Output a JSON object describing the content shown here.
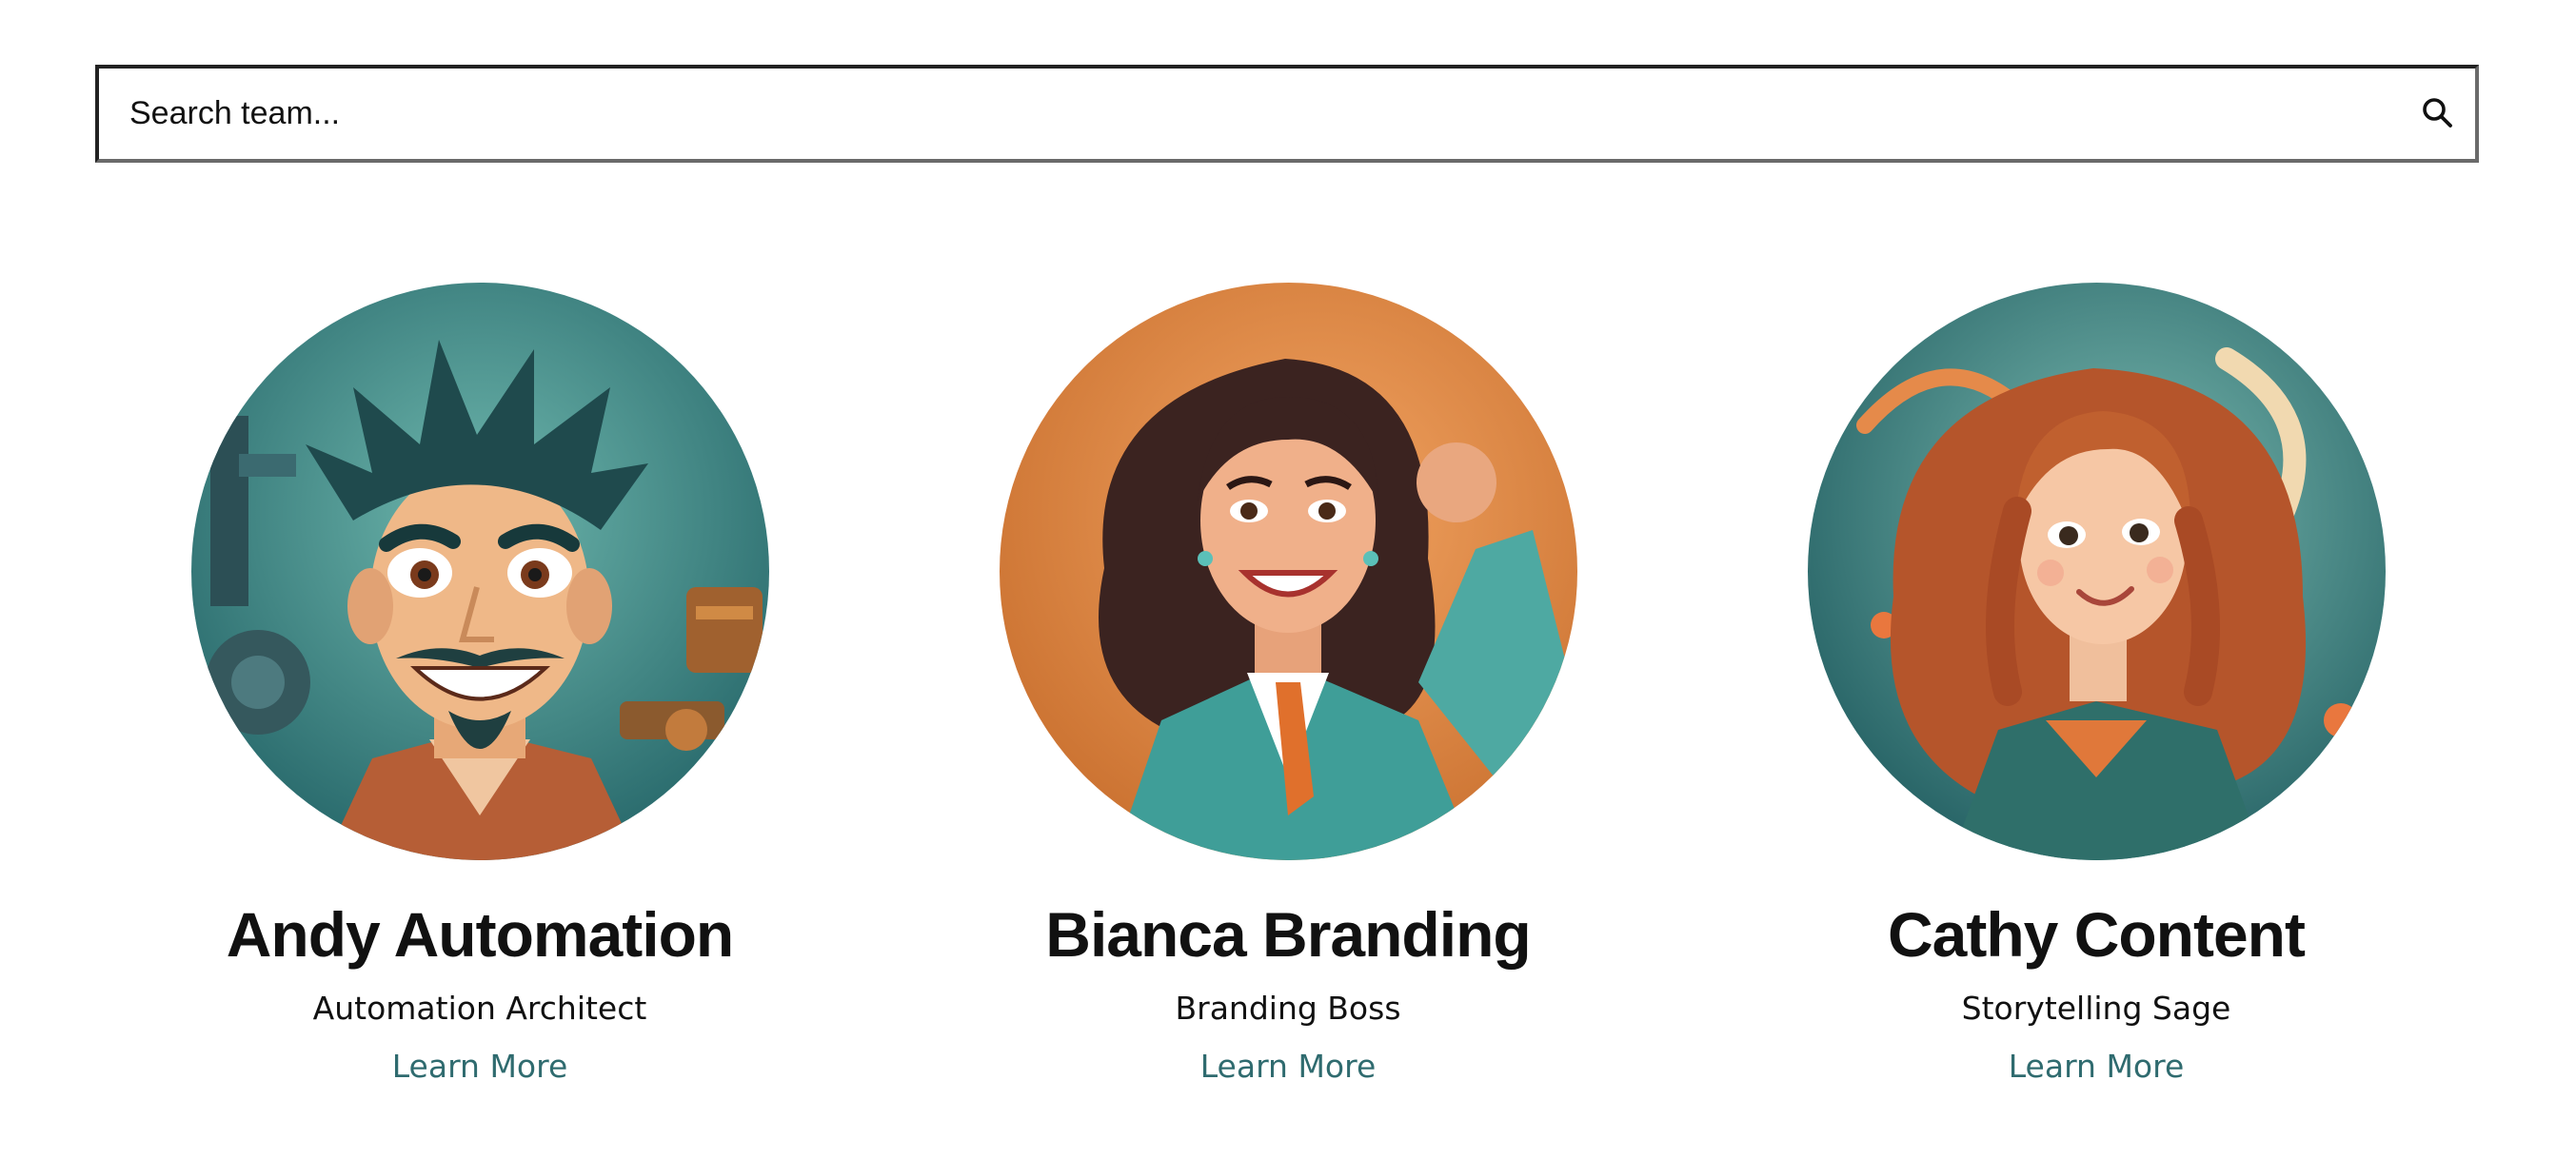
{
  "search": {
    "placeholder": "Search team...",
    "icon": "search-icon"
  },
  "colors": {
    "link": "#2f6b6f",
    "text": "#111111",
    "search_border": "#222222"
  },
  "team": [
    {
      "name": "Andy Automation",
      "role": "Automation Architect",
      "link_label": "Learn More",
      "avatar": "cartoon-portrait-man-teal-background"
    },
    {
      "name": "Bianca Branding",
      "role": "Branding Boss",
      "link_label": "Learn More",
      "avatar": "cartoon-portrait-woman-orange-background"
    },
    {
      "name": "Cathy Content",
      "role": "Storytelling Sage",
      "link_label": "Learn More",
      "avatar": "cartoon-portrait-redhead-woman-teal-background"
    }
  ]
}
